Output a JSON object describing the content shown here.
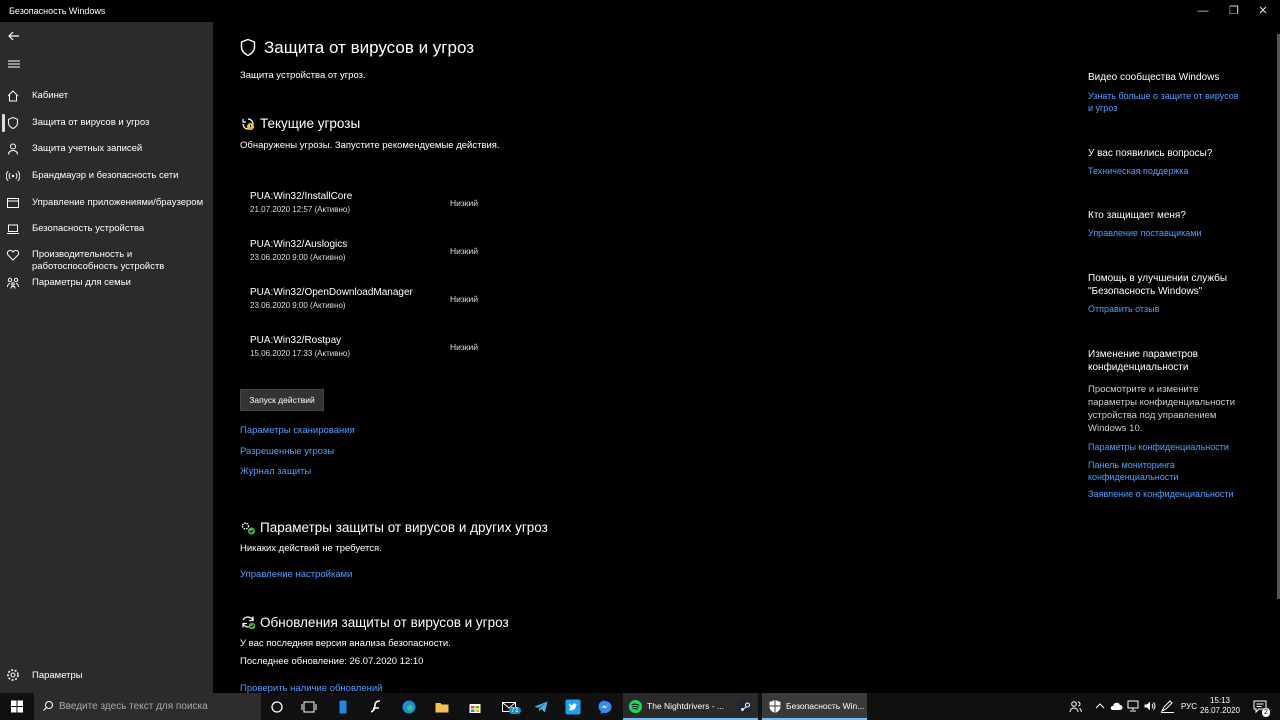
{
  "window": {
    "title": "Безопасность Windows",
    "minimize": "—",
    "maximize": "❐",
    "close": "✕"
  },
  "sidebar": {
    "items": [
      {
        "label": "Кабинет"
      },
      {
        "label": "Защита от вирусов и угроз"
      },
      {
        "label": "Защита учетных записей"
      },
      {
        "label": "Брандмауэр и безопасность сети"
      },
      {
        "label": "Управление приложениями/браузером"
      },
      {
        "label": "Безопасность устройства"
      },
      {
        "label": "Производительность и",
        "label2": "работоспособность устройств"
      },
      {
        "label": "Параметры для семьи"
      }
    ],
    "settings_label": "Параметры"
  },
  "main": {
    "title": "Защита от вирусов и угроз",
    "subtitle": "Защита устройства от угроз.",
    "current_threats": {
      "title": "Текущие угрозы",
      "description": "Обнаружены угрозы. Запустите рекомендуемые действия.",
      "threats": [
        {
          "name": "PUA:Win32/InstallCore",
          "date": "21.07.2020 12:57 (Активно)",
          "level": "Низкий"
        },
        {
          "name": "PUA:Win32/Auslogics",
          "date": "23.06.2020 9:00 (Активно)",
          "level": "Низкий"
        },
        {
          "name": "PUA:Win32/OpenDownloadManager",
          "date": "23.06.2020 9:00 (Активно)",
          "level": "Низкий"
        },
        {
          "name": "PUA:Win32/Rostpay",
          "date": "15.06.2020 17:33 (Активно)",
          "level": "Низкий"
        }
      ],
      "action_button": "Запуск действий",
      "links": [
        "Параметры сканирования",
        "Разрешенные угрозы",
        "Журнал защиты"
      ]
    },
    "protection_settings": {
      "title": "Параметры защиты от вирусов и других угроз",
      "description": "Никаких действий не требуется.",
      "link": "Управление настройками"
    },
    "updates": {
      "title": "Обновления защиты от вирусов и угроз",
      "line1": "У вас последняя версия анализа безопасности.",
      "line2": "Последнее обновление: 26.07.2020 12:10",
      "link": "Проверить наличие обновлений"
    }
  },
  "right": {
    "community": {
      "heading": "Видео сообщества Windows",
      "link1": "Узнать больше о защите от вирусов",
      "link2": "и угроз"
    },
    "questions": {
      "heading": "У вас появились вопросы?",
      "link": "Техническая поддержка"
    },
    "who": {
      "heading": "Кто защищает меня?",
      "link": "Управление поставщиками"
    },
    "help": {
      "heading1": "Помощь в улучшении службы",
      "heading2": "\"Безопасность Windows\"",
      "link": "Отправить отзыв"
    },
    "privacy": {
      "heading1": "Изменение параметров",
      "heading2": "конфиденциальности",
      "text1": "Просмотрите и измените",
      "text2": "параметры конфиденциальности",
      "text3": "устройства под управлением",
      "text4": "Windows 10.",
      "link1": "Параметры конфиденциальности",
      "link2a": "Панель мониторинга",
      "link2b": "конфиденциальности",
      "link3": "Заявление о конфиденциальности"
    }
  },
  "taskbar": {
    "search_placeholder": "Введите здесь текст для поиска",
    "mail_badge": "71",
    "app1": "The Nightdrivers - ...",
    "app2": "Безопасность Win...",
    "lang": "РУС",
    "time": "15:13",
    "date": "26.07.2020",
    "notif_count": "2",
    "accent": "#76b9ed"
  },
  "colors": {
    "link": "#4ca0ff",
    "sidebar_bg": "#2b2b2b",
    "main_bg": "#000000"
  }
}
